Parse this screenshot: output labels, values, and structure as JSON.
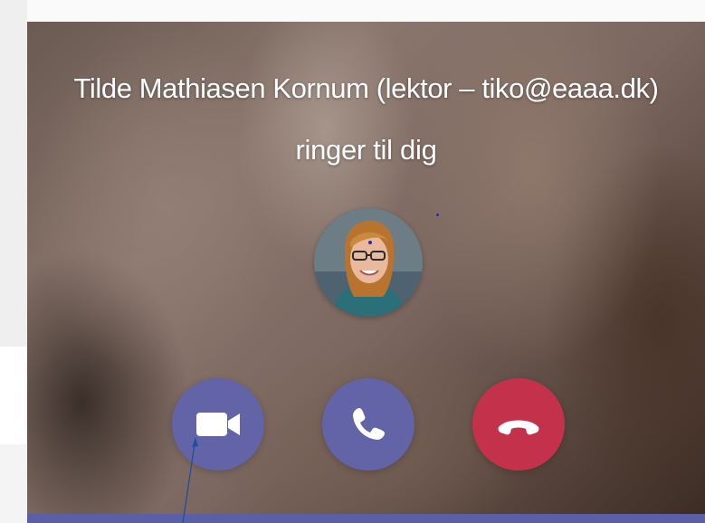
{
  "call": {
    "caller_name": "Tilde Mathiasen Kornum (lektor – tiko@eaaa.dk)",
    "status": "ringer til dig"
  },
  "actions": {
    "video_icon": "video-camera-icon",
    "audio_icon": "phone-icon",
    "decline_icon": "hang-up-icon"
  },
  "colors": {
    "accent": "#6264a7",
    "decline": "#c4314b",
    "bottom_bar": "#5b5fa6"
  }
}
